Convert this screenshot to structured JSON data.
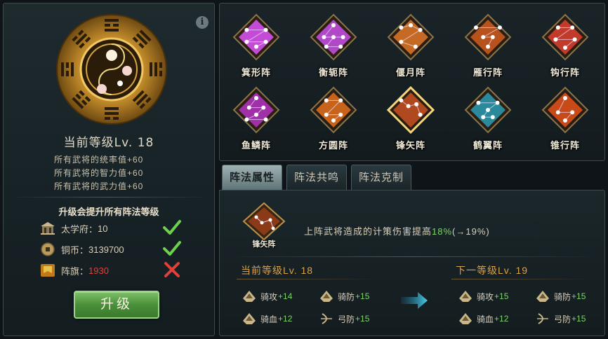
{
  "left": {
    "info_icon": "i",
    "level_title": "当前等级Lv. 18",
    "bonuses": [
      "所有武将的统率值+60",
      "所有武将的智力值+60",
      "所有武将的武力值+60"
    ],
    "upgrade_note": "升级会提升所有阵法等级",
    "requirements": [
      {
        "icon": "academy-icon",
        "label": "太学府：",
        "value": "10",
        "met": true
      },
      {
        "icon": "coin-icon",
        "label": "铜币：",
        "value": "3139700",
        "met": true
      },
      {
        "icon": "banner-icon",
        "label": "阵旗：",
        "value": "1930",
        "met": false
      }
    ],
    "upgrade_button": "升级"
  },
  "formations": [
    {
      "name": "箕形阵",
      "color": "#c44bd6"
    },
    {
      "name": "衡轭阵",
      "color": "#b048c8"
    },
    {
      "name": "偃月阵",
      "color": "#c46a24"
    },
    {
      "name": "雁行阵",
      "color": "#b8521c"
    },
    {
      "name": "钩行阵",
      "color": "#c23a2a"
    },
    {
      "name": "鱼鳞阵",
      "color": "#a030a8"
    },
    {
      "name": "方圆阵",
      "color": "#c8631c"
    },
    {
      "name": "锋矢阵",
      "color": "#b04820"
    },
    {
      "name": "鹤翼阵",
      "color": "#2a8a9c"
    },
    {
      "name": "锥行阵",
      "color": "#c84a18"
    }
  ],
  "selected_index": 7,
  "tabs": [
    "阵法属性",
    "阵法共鸣",
    "阵法克制"
  ],
  "active_tab": 0,
  "detail": {
    "formation_name": "锋矢阵",
    "effect_prefix": "上阵武将造成的计策伤害提高",
    "effect_current": "18%",
    "effect_next": "(→19%)",
    "current_level_title": "当前等级Lv. 18",
    "next_level_title": "下一等级Lv. 19",
    "current_stats": [
      {
        "icon": "cavalry-attack-icon",
        "name": "骑攻",
        "value": "+14"
      },
      {
        "icon": "cavalry-defense-icon",
        "name": "骑防",
        "value": "+15"
      },
      {
        "icon": "cavalry-hp-icon",
        "name": "骑血",
        "value": "+12"
      },
      {
        "icon": "archer-defense-icon",
        "name": "弓防",
        "value": "+15"
      }
    ],
    "next_stats": [
      {
        "icon": "cavalry-attack-icon",
        "name": "骑攻",
        "value": "+15"
      },
      {
        "icon": "cavalry-defense-icon",
        "name": "骑防",
        "value": "+15"
      },
      {
        "icon": "cavalry-hp-icon",
        "name": "骑血",
        "value": "+12"
      },
      {
        "icon": "archer-defense-icon",
        "name": "弓防",
        "value": "+15"
      }
    ]
  },
  "colors": {
    "accent_green": "#7ed36a",
    "warn_red": "#e0403a",
    "gold": "#d9a14b"
  }
}
